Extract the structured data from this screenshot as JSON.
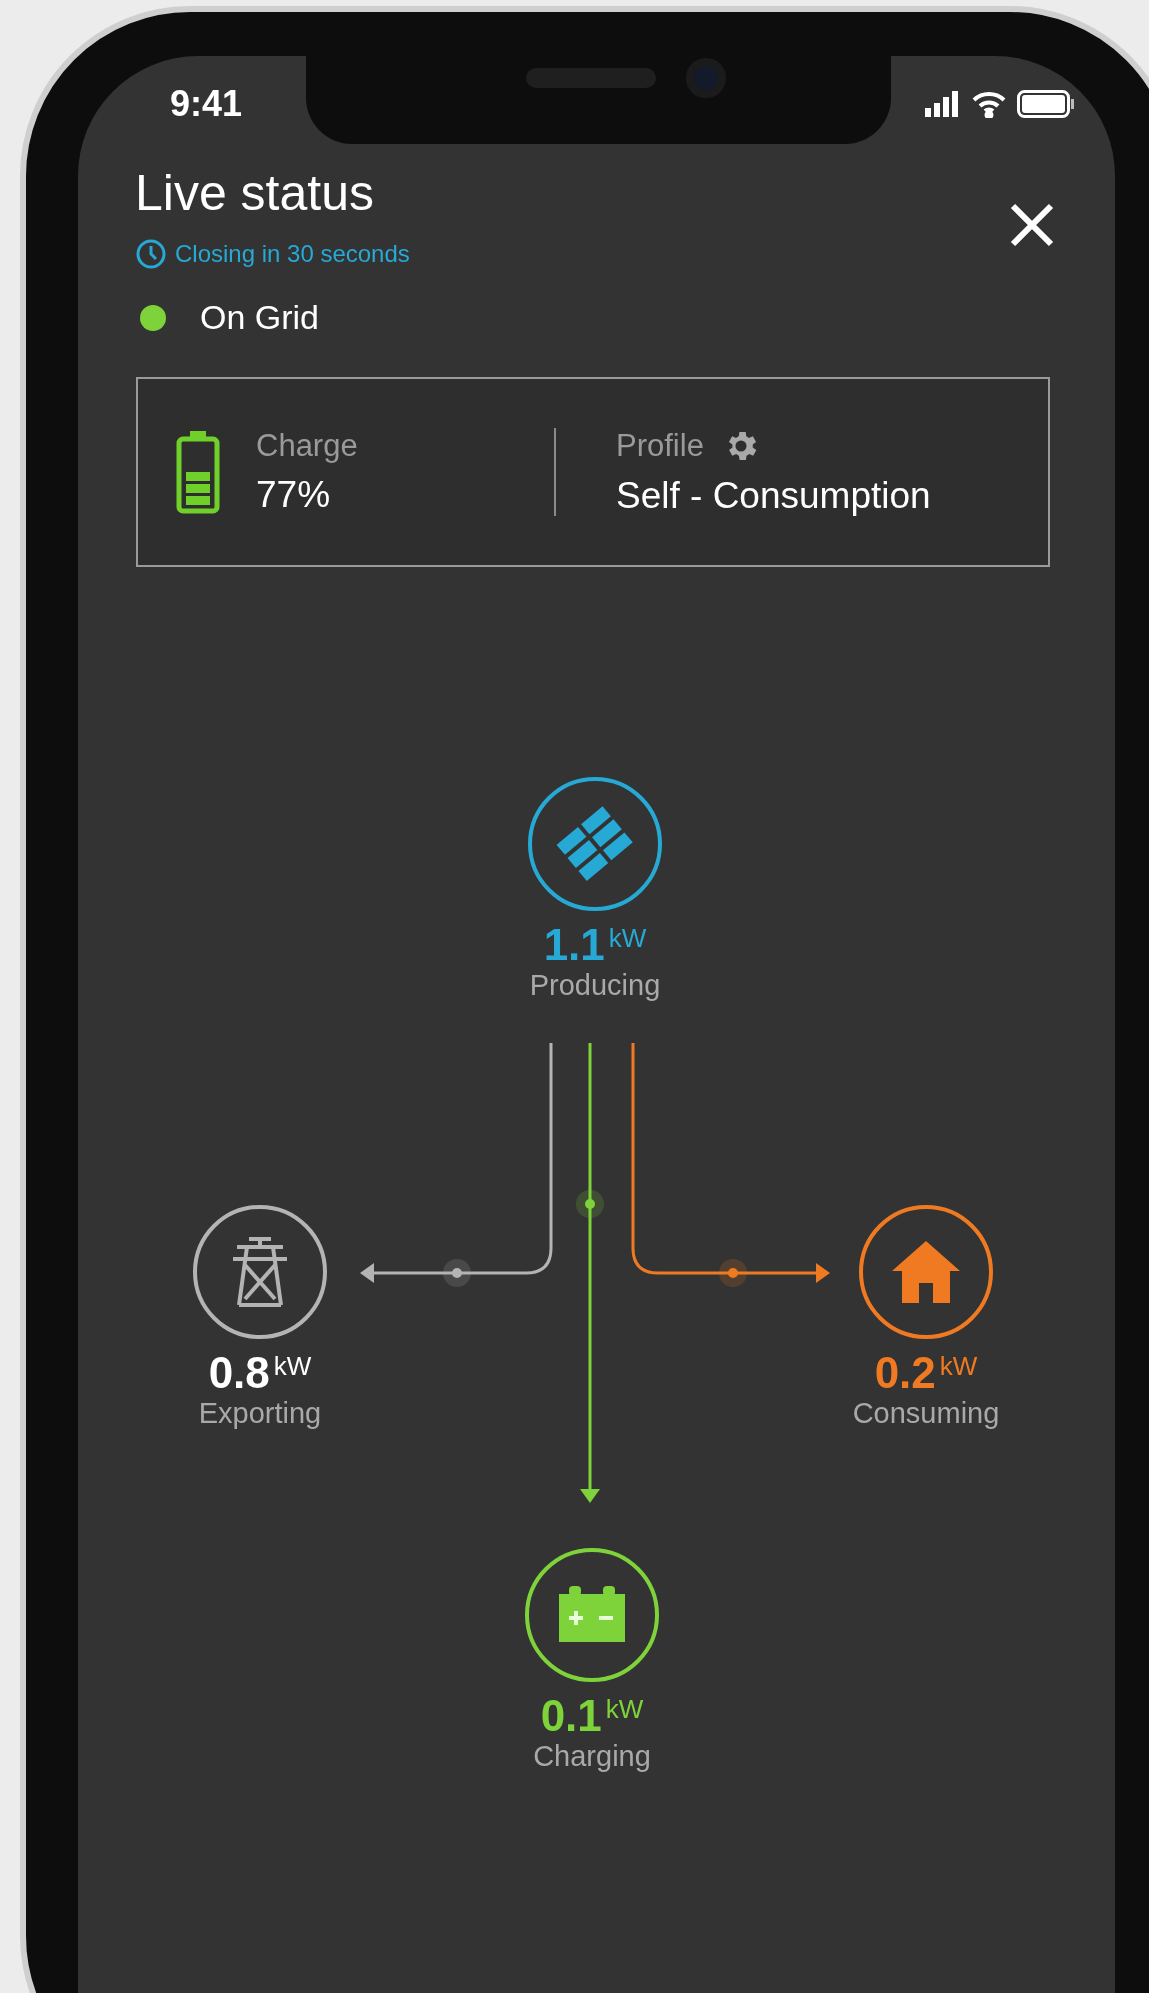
{
  "status_bar": {
    "time": "9:41"
  },
  "header": {
    "title": "Live status",
    "countdown": "Closing in 30 seconds"
  },
  "grid_status": {
    "label": "On Grid",
    "color": "#7ed23a"
  },
  "summary": {
    "charge_label": "Charge",
    "charge_value": "77%",
    "profile_label": "Profile",
    "profile_value": "Self - Consumption"
  },
  "nodes": [
    {
      "kind": "solar",
      "value": "1.1",
      "unit": "kW",
      "label": "Producing",
      "color": "#26a9d4"
    },
    {
      "kind": "grid",
      "value": "0.8",
      "unit": "kW",
      "label": "Exporting",
      "color": "#b4b4b4"
    },
    {
      "kind": "home",
      "value": "0.2",
      "unit": "kW",
      "label": "Consuming",
      "color": "#f07a22"
    },
    {
      "kind": "battery",
      "value": "0.1",
      "unit": "kW",
      "label": "Charging",
      "color": "#7ed23a"
    }
  ]
}
